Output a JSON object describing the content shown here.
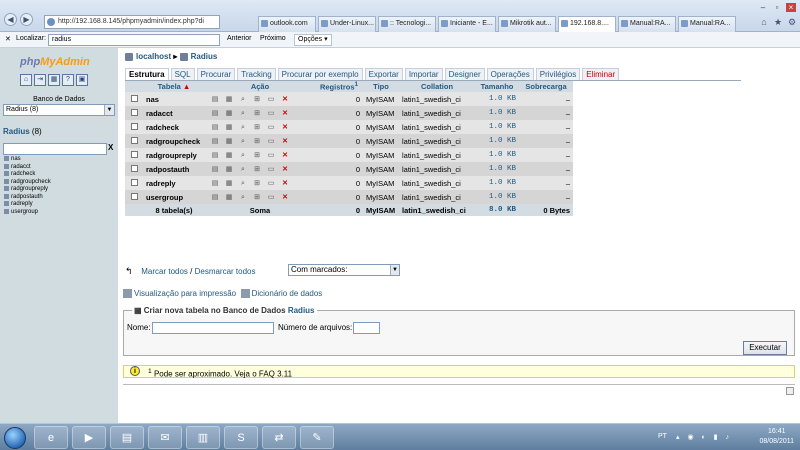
{
  "browser": {
    "url": "http://192.168.8.145/phpmyadmin/index.php?di",
    "tabs": [
      "outlook.com",
      "Under-Linux...",
      ":: Tecnologi...",
      "Iniciante - E...",
      "Mikrotik aut...",
      "192.168.8....",
      "Manual:RA...",
      "Manual:RA..."
    ],
    "active_tab": 5
  },
  "findbar": {
    "close": "✕",
    "label": "Localizar:",
    "query": "radius",
    "prev": "Anterior",
    "next": "Próximo",
    "options": "Opções"
  },
  "sidebar": {
    "logo_php": "php",
    "logo_my": "MyAdmin",
    "db_label": "Banco de Dados",
    "db_select": "Radius (8)",
    "db_title": "Radius",
    "db_count": "(8)",
    "filter_clear": "X",
    "tables": [
      "nas",
      "radacct",
      "radcheck",
      "radgroupcheck",
      "radgroupreply",
      "radpostauth",
      "radreply",
      "usergroup"
    ]
  },
  "breadcrumb": {
    "server": "localhost",
    "db": "Radius"
  },
  "tabs": {
    "structure": "Estrutura",
    "sql": "SQL",
    "search": "Procurar",
    "tracking": "Tracking",
    "query": "Procurar por exemplo",
    "export": "Exportar",
    "import": "Importar",
    "designer": "Designer",
    "operations": "Operações",
    "privileges": "Privilégios",
    "drop": "Eliminar"
  },
  "table": {
    "headers": {
      "table": "Tabela",
      "action": "Ação",
      "records": "Registros",
      "records_sup": "1",
      "type": "Tipo",
      "collation": "Collation",
      "size": "Tamanho",
      "overhead": "Sobrecarga"
    },
    "rows": [
      {
        "name": "nas",
        "records": "0",
        "type": "MyISAM",
        "collation": "latin1_swedish_ci",
        "size": "1.0 KB",
        "overhead": "–"
      },
      {
        "name": "radacct",
        "records": "0",
        "type": "MyISAM",
        "collation": "latin1_swedish_ci",
        "size": "1.0 KB",
        "overhead": "–"
      },
      {
        "name": "radcheck",
        "records": "0",
        "type": "MyISAM",
        "collation": "latin1_swedish_ci",
        "size": "1.0 KB",
        "overhead": "–"
      },
      {
        "name": "radgroupcheck",
        "records": "0",
        "type": "MyISAM",
        "collation": "latin1_swedish_ci",
        "size": "1.0 KB",
        "overhead": "–"
      },
      {
        "name": "radgroupreply",
        "records": "0",
        "type": "MyISAM",
        "collation": "latin1_swedish_ci",
        "size": "1.0 KB",
        "overhead": "–"
      },
      {
        "name": "radpostauth",
        "records": "0",
        "type": "MyISAM",
        "collation": "latin1_swedish_ci",
        "size": "1.0 KB",
        "overhead": "–"
      },
      {
        "name": "radreply",
        "records": "0",
        "type": "MyISAM",
        "collation": "latin1_swedish_ci",
        "size": "1.0 KB",
        "overhead": "–"
      },
      {
        "name": "usergroup",
        "records": "0",
        "type": "MyISAM",
        "collation": "latin1_swedish_ci",
        "size": "1.0 KB",
        "overhead": "–"
      }
    ],
    "footer": {
      "count": "8 tabela(s)",
      "sum": "Soma",
      "records": "0",
      "type": "MyISAM",
      "collation": "latin1_swedish_ci",
      "size": "8.0 KB",
      "overhead": "0 Bytes"
    }
  },
  "marking": {
    "check_all": "Marcar todos",
    "separator": " / ",
    "uncheck_all": "Desmarcar todos",
    "with_selected": "Com marcados:"
  },
  "links": {
    "print": "Visualização para impressão",
    "dictionary": "Dicionário de dados"
  },
  "create": {
    "legend": "Criar nova tabela no Banco de Dados",
    "db": "Radius",
    "name_label": "Nome:",
    "fields_label": "Número de arquivos:",
    "execute": "Executar"
  },
  "notice": {
    "sup": "1",
    "text": "Pode ser aproximado. Veja o FAQ 3.11"
  },
  "taskbar": {
    "lang": "PT",
    "time": "16:41",
    "date": "08/08/2011"
  }
}
